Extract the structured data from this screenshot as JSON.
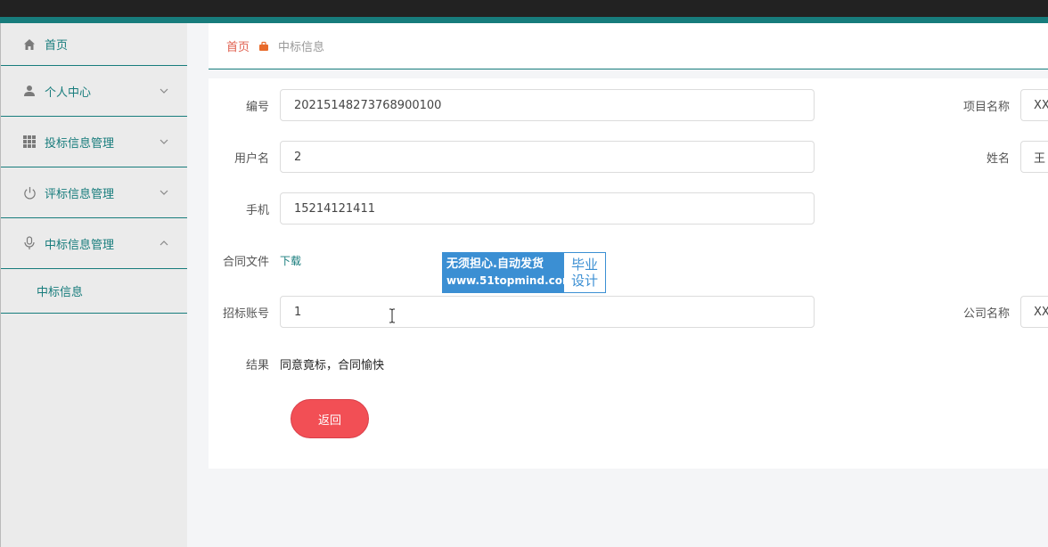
{
  "sidebar": {
    "items": [
      {
        "label": "首页",
        "icon": "home-icon"
      },
      {
        "label": "个人中心",
        "icon": "user-icon"
      },
      {
        "label": "投标信息管理",
        "icon": "grid-icon"
      },
      {
        "label": "评标信息管理",
        "icon": "power-icon"
      },
      {
        "label": "中标信息管理",
        "icon": "microphone-icon"
      }
    ],
    "subitem": "中标信息"
  },
  "breadcrumb": {
    "home": "首页",
    "current": "中标信息"
  },
  "form": {
    "number_label": "编号",
    "number_value": "20215148273768900100",
    "username_label": "用户名",
    "username_value": "2",
    "phone_label": "手机",
    "phone_value": "15214121411",
    "contract_label": "合同文件",
    "contract_link": "下载",
    "account_label": "招标账号",
    "account_value": "1",
    "result_label": "结果",
    "result_value": "同意竟标，合同愉快",
    "project_label": "项目名称",
    "project_value": "XX",
    "name_label": "姓名",
    "name_value": "王",
    "company_label": "公司名称",
    "company_value": "XX",
    "back_button": "返回"
  },
  "watermark": {
    "line1": "无须担心.自动发货",
    "line2": "www.51topmind.com",
    "right1": "毕业",
    "right2": "设计"
  },
  "colors": {
    "accent": "#177c7c",
    "button": "#f24f55",
    "home_link": "#e0604f"
  }
}
